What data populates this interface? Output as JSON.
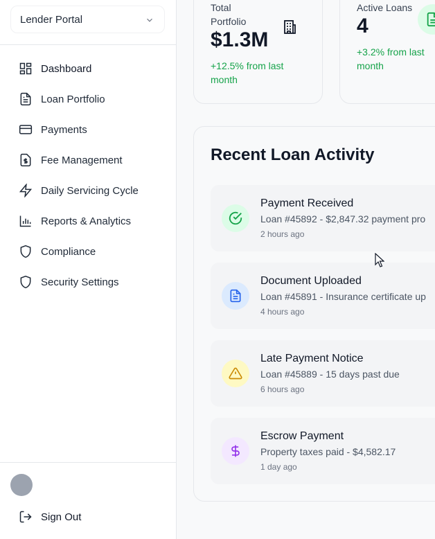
{
  "sidebar": {
    "portal_select": "Lender Portal",
    "items": [
      {
        "label": "Dashboard",
        "icon": "grid-icon"
      },
      {
        "label": "Loan Portfolio",
        "icon": "document-icon"
      },
      {
        "label": "Payments",
        "icon": "credit-card-icon"
      },
      {
        "label": "Fee Management",
        "icon": "dollar-file-icon"
      },
      {
        "label": "Daily Servicing Cycle",
        "icon": "lightning-icon"
      },
      {
        "label": "Reports & Analytics",
        "icon": "bar-chart-icon"
      },
      {
        "label": "Compliance",
        "icon": "shield-icon"
      },
      {
        "label": "Security Settings",
        "icon": "shield-icon"
      }
    ],
    "sign_out": "Sign Out"
  },
  "stats": [
    {
      "label": "Total Portfolio",
      "value": "$1.3M",
      "change": "+12.5% from last month"
    },
    {
      "label": "Active Loans",
      "value": "4",
      "change": "+3.2% from last month"
    }
  ],
  "activity": {
    "title": "Recent Loan Activity",
    "items": [
      {
        "title": "Payment Received",
        "desc": "Loan #45892 - $2,847.32 payment pro",
        "time": "2 hours ago",
        "icon": "check-circle-icon",
        "bg": "#dcfce7",
        "color": "#16a34a"
      },
      {
        "title": "Document Uploaded",
        "desc": "Loan #45891 - Insurance certificate up",
        "time": "4 hours ago",
        "icon": "document-icon",
        "bg": "#dbeafe",
        "color": "#2563eb"
      },
      {
        "title": "Late Payment Notice",
        "desc": "Loan #45889 - 15 days past due",
        "time": "6 hours ago",
        "icon": "warning-icon",
        "bg": "#fef9c3",
        "color": "#ca8a04"
      },
      {
        "title": "Escrow Payment",
        "desc": "Property taxes paid - $4,582.17",
        "time": "1 day ago",
        "icon": "dollar-icon",
        "bg": "#f3e8ff",
        "color": "#9333ea"
      }
    ]
  },
  "colors": {
    "accent_green": "#16a34a",
    "text": "#111827",
    "border": "#e5e7eb"
  }
}
